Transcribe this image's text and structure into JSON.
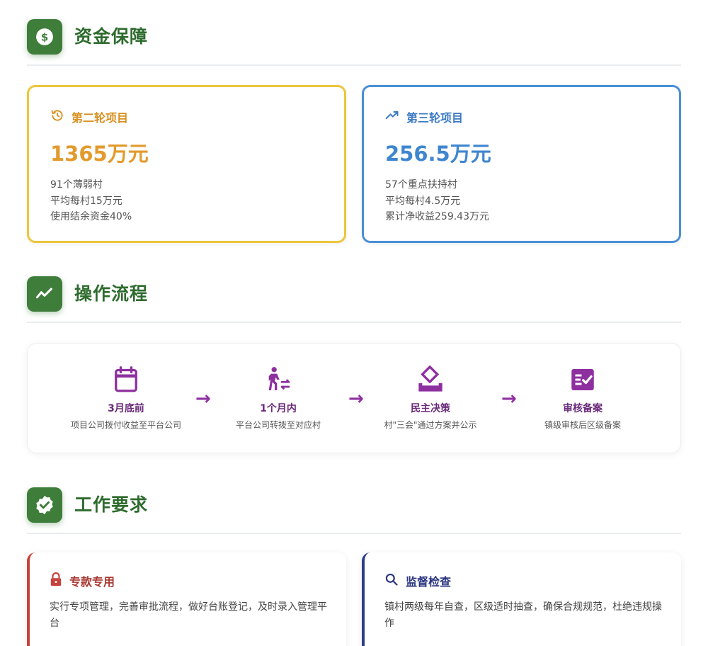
{
  "sections": {
    "funding": {
      "title": "资金保障",
      "icon": "dollar-icon"
    },
    "process": {
      "title": "操作流程",
      "icon": "trend-icon"
    },
    "requirements": {
      "title": "工作要求",
      "icon": "verified-badge-icon"
    }
  },
  "funding_cards": [
    {
      "title": "第二轮项目",
      "icon": "history-icon",
      "amount": "1365万元",
      "lines": [
        "91个薄弱村",
        "平均每村15万元",
        "使用结余资金40%"
      ],
      "color": "#e39a2d"
    },
    {
      "title": "第三轮项目",
      "icon": "trending-up-icon",
      "amount": "256.5万元",
      "lines": [
        "57个重点扶持村",
        "平均每村4.5万元",
        "累计净收益259.43万元"
      ],
      "color": "#3f86cf"
    }
  ],
  "steps": [
    {
      "title": "3月底前",
      "desc": "项目公司拨付收益至平台公司",
      "icon": "calendar-icon"
    },
    {
      "title": "1个月内",
      "desc": "平台公司转拨至对应村",
      "icon": "transfer-walk-icon"
    },
    {
      "title": "民主决策",
      "desc": "村\"三会\"通过方案并公示",
      "icon": "vote-icon"
    },
    {
      "title": "审核备案",
      "desc": "镇级审核后区级备案",
      "icon": "checklist-icon"
    }
  ],
  "requirements": [
    {
      "title": "专款专用",
      "icon": "lock-icon",
      "text": "实行专项管理，完善审批流程，做好台账登记，及时录入管理平台",
      "color": "#c8423b"
    },
    {
      "title": "监督检查",
      "icon": "search-icon",
      "text": "镇村两级每年自查，区级适时抽查，确保合规规范，杜绝违规操作",
      "color": "#2f3c8e"
    }
  ],
  "colors": {
    "green": "#3f7d3b",
    "purple": "#8e2fa0"
  }
}
